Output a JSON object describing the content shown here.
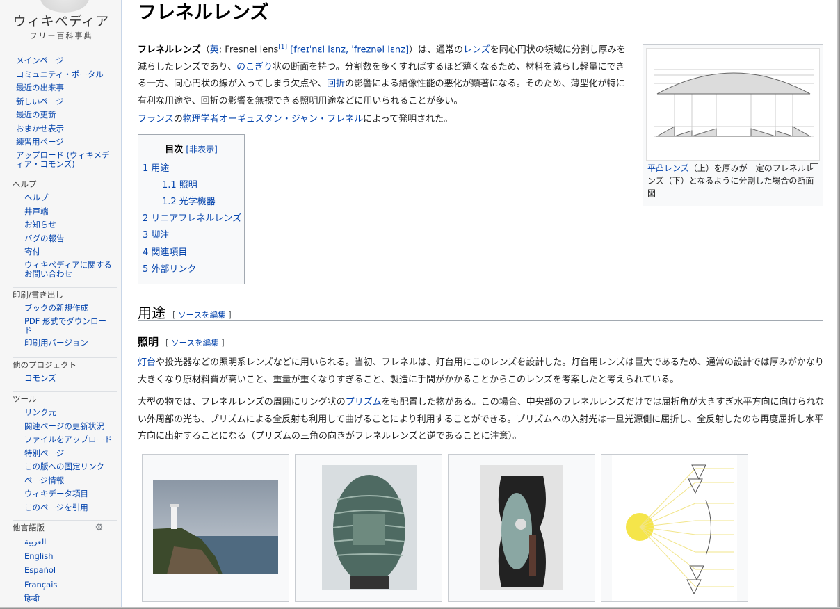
{
  "logo": {
    "title": "ウィキペディア",
    "subtitle": "フリー百科事典"
  },
  "nav_main": [
    "メインページ",
    "コミュニティ・ポータル",
    "最近の出来事",
    "新しいページ",
    "最近の更新",
    "おまかせ表示",
    "練習用ページ",
    "アップロード (ウィキメディア・コモンズ)"
  ],
  "help": {
    "heading": "ヘルプ",
    "items": [
      "ヘルプ",
      "井戸端",
      "お知らせ",
      "バグの報告",
      "寄付",
      "ウィキペディアに関するお問い合わせ"
    ]
  },
  "print": {
    "heading": "印刷/書き出し",
    "items": [
      "ブックの新規作成",
      "PDF 形式でダウンロード",
      "印刷用バージョン"
    ]
  },
  "projects": {
    "heading": "他のプロジェクト",
    "items": [
      "コモンズ"
    ]
  },
  "tools": {
    "heading": "ツール",
    "items": [
      "リンク元",
      "関連ページの更新状況",
      "ファイルをアップロード",
      "特別ページ",
      "この版への固定リンク",
      "ページ情報",
      "ウィキデータ項目",
      "このページを引用"
    ]
  },
  "languages": {
    "heading": "他言語版",
    "items": [
      "العربية",
      "English",
      "Español",
      "Français",
      "हिन्दी"
    ]
  },
  "article": {
    "title": "フレネルレンズ",
    "intro": {
      "bold": "フレネルレンズ",
      "t1": "（",
      "l1": "英",
      "t2": ": Fresnel lens",
      "ref": "[1]",
      "l2": " [freɪˈnɛl lɛnz, ˈfreznəl lɛnz]",
      "t3": "）は、通常の",
      "l3": "レンズ",
      "t4": "を同心円状の領域に分割し厚みを減らしたレンズであり、",
      "l4": "のこぎり",
      "t5": "状の断面を持つ。分割数を多くすればするほど薄くなるため、材料を減らし軽量にできる一方、同心円状の線が入ってしまう欠点や、",
      "l5": "回折",
      "t6": "の影響による結像性能の悪化が顕著になる。そのため、薄型化が特に有利な用途や、回折の影響を無視できる照明用途などに用いられることが多い。"
    },
    "p2": {
      "l1": "フランス",
      "t1": "の",
      "l2": "物理学者",
      "l3": "オーギュスタン・ジャン・フレネル",
      "t2": "によって発明された。"
    },
    "thumb_caption": {
      "l1": "平凸レンズ",
      "t1": "（上）を厚みが一定のフレネルレンズ（下）となるように分割した場合の断面図"
    },
    "toc": {
      "title": "目次",
      "toggle": "[非表示]",
      "items": [
        "1 用途",
        "1.1 照明",
        "1.2 光学機器",
        "2 リニアフレネルレンズ",
        "3 脚注",
        "4 関連項目",
        "5 外部リンク"
      ]
    },
    "section_usage": {
      "title": "用途",
      "edit_open": "[ ",
      "edit_link": "ソースを編集",
      "edit_close": " ]"
    },
    "sub_lighting": {
      "title": "照明",
      "edit_open": "[ ",
      "edit_link": "ソースを編集",
      "edit_close": " ]"
    },
    "p3": {
      "l1": "灯台",
      "t1": "や投光器などの照明系レンズなどに用いられる。当初、フレネルは、灯台用にこのレンズを設計した。灯台用レンズは巨大であるため、通常の設計では厚みがかなり大きくなり原材料費が高いこと、重量が重くなりすぎること、製造に手間がかかることからこのレンズを考案したと考えられている。"
    },
    "p4": {
      "t1": "大型の物では、フレネルレンズの周囲にリング状の",
      "l1": "プリズム",
      "t2": "をも配置した物がある。この場合、中央部のフレネルレンズだけでは屈折角が大きすぎ水平方向に向けられない外周部の光も、プリズムによる全反射も利用して曲げることにより利用することができる。プリズムへの入射光は一旦光源側に屈折し、全反射したのち再度屈折し水平方向に出射することになる（プリズムの三角の向きがフレネルレンズと逆であることに注意）。"
    }
  },
  "colors": {
    "link": "#0645ad",
    "sidebar_bg": "#f6f6f6",
    "border": "#a2a9b1"
  }
}
